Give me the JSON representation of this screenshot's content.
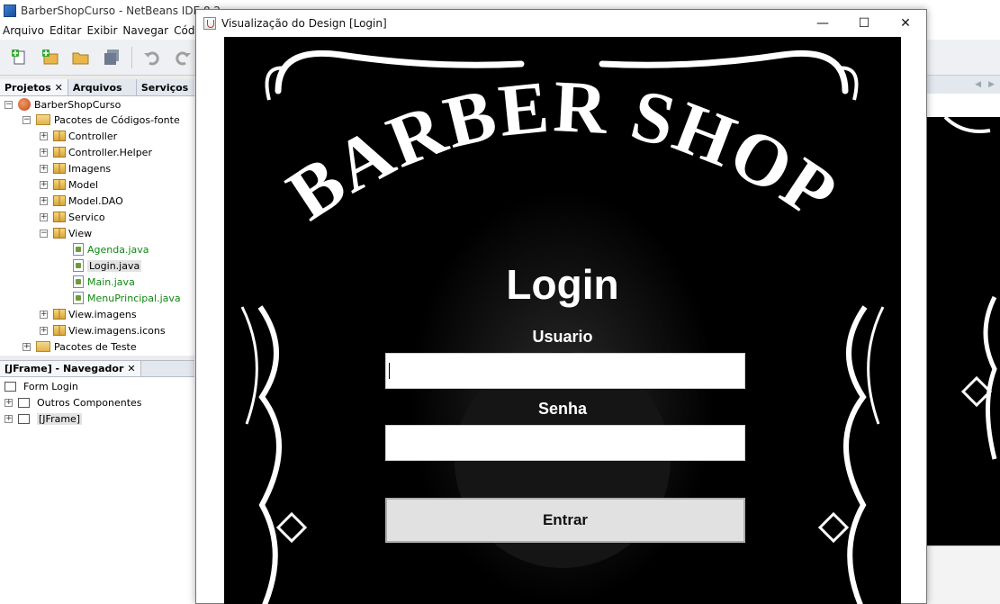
{
  "ide": {
    "title": "BarberShopCurso - NetBeans IDE 8.2",
    "menu": [
      "Arquivo",
      "Editar",
      "Exibir",
      "Navegar",
      "Códig"
    ],
    "project_tabs": [
      {
        "label": "Projetos",
        "close": "✕"
      },
      {
        "label": "Arquivos"
      },
      {
        "label": "Serviços"
      }
    ],
    "tree": {
      "project": "BarberShopCurso",
      "source_packages": "Pacotes de Códigos-fonte",
      "packages": [
        "Controller",
        "Controller.Helper",
        "Imagens",
        "Model",
        "Model.DAO",
        "Servico",
        "View"
      ],
      "view_files": [
        "Agenda.java",
        "Login.java",
        "Main.java",
        "MenuPrincipal.java"
      ],
      "more_packages": [
        "View.imagens",
        "View.imagens.icons"
      ],
      "test_packages": "Pacotes de Teste"
    },
    "navigator": {
      "tab": "[JFrame] - Navegador",
      "close": "✕",
      "items": [
        "Form Login",
        "Outros Componentes",
        "[JFrame]"
      ]
    }
  },
  "preview": {
    "title": "Visualização do Design [Login]",
    "controls": {
      "minimize": "—",
      "maximize": "☐",
      "close": "✕"
    },
    "logo_text": "BARBER SHOP",
    "form": {
      "title": "Login",
      "user_label": "Usuario",
      "user_value": "",
      "password_label": "Senha",
      "password_value": "",
      "submit_label": "Entrar"
    }
  },
  "colors": {
    "panel_bg": "#000000",
    "text_on_dark": "#ffffff",
    "button_bg": "#e1e1e1"
  }
}
